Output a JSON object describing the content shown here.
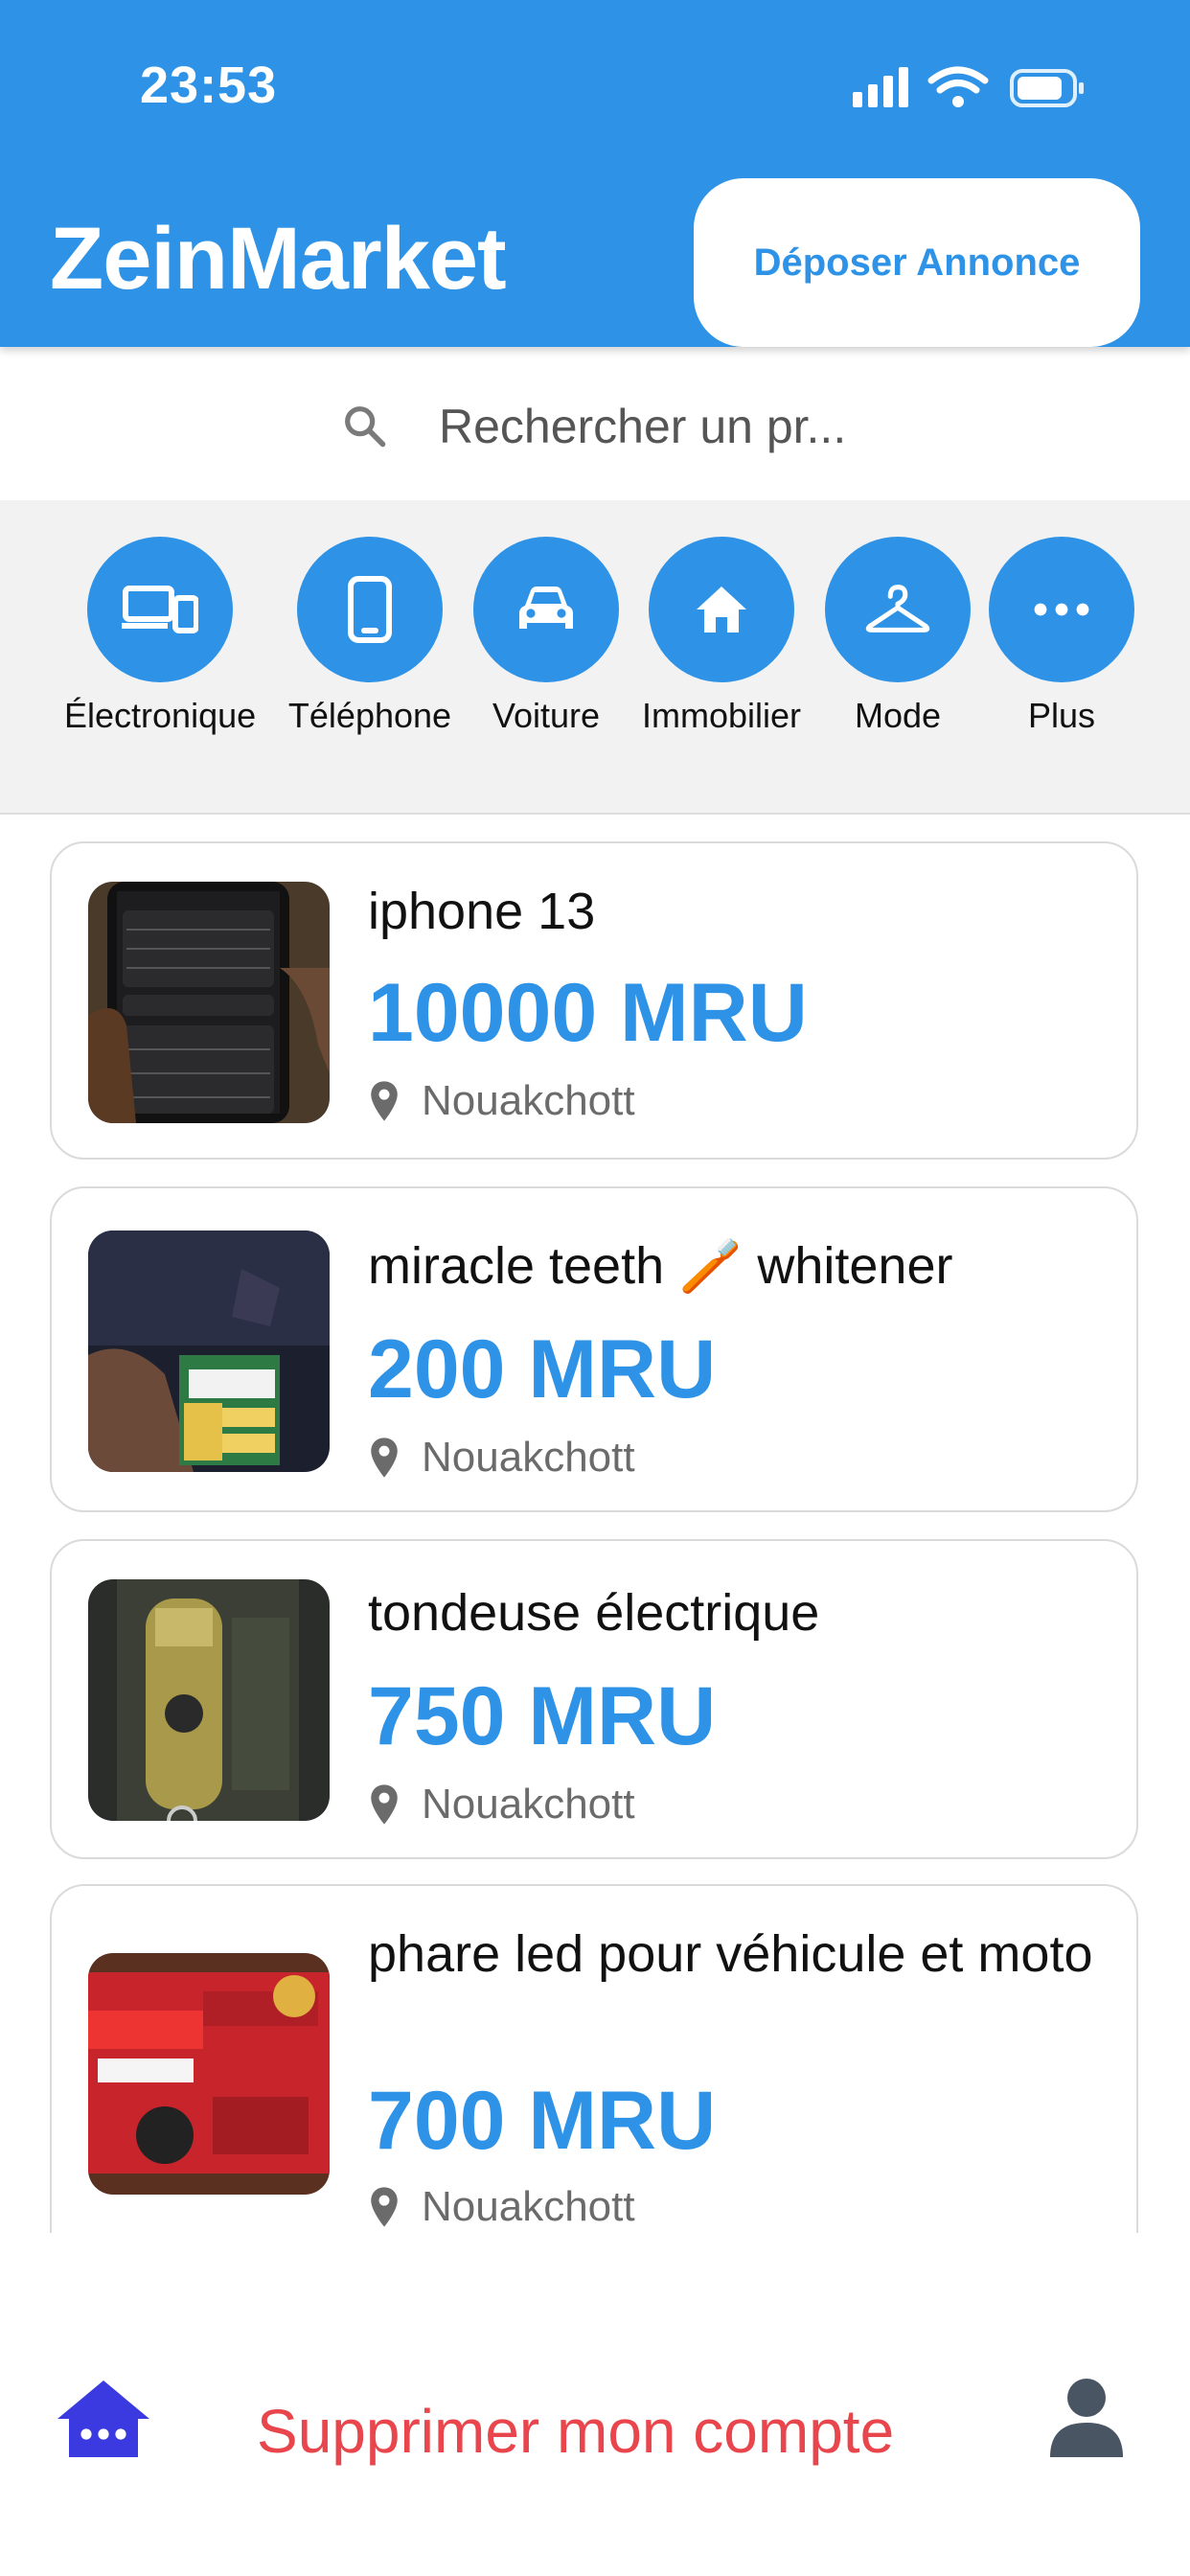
{
  "status_bar": {
    "time": "23:53"
  },
  "header": {
    "app_title": "ZeinMarket",
    "post_button_label": "Déposer Annonce"
  },
  "search": {
    "placeholder": "Rechercher un pr..."
  },
  "categories": [
    {
      "label": "Électronique",
      "icon": "devices-icon"
    },
    {
      "label": "Téléphone",
      "icon": "phone-icon"
    },
    {
      "label": "Voiture",
      "icon": "car-icon"
    },
    {
      "label": "Immobilier",
      "icon": "home-icon"
    },
    {
      "label": "Mode",
      "icon": "hanger-icon"
    },
    {
      "label": "Plus",
      "icon": "more-icon"
    }
  ],
  "listings": [
    {
      "title": "iphone 13",
      "price": "10000 MRU",
      "location": "Nouakchott"
    },
    {
      "title": "miracle teeth 🪥 whitener",
      "price": "200 MRU",
      "location": "Nouakchott"
    },
    {
      "title": "tondeuse électrique",
      "price": "750 MRU",
      "location": "Nouakchott"
    },
    {
      "title": "phare led pour véhicule et moto",
      "price": "700 MRU",
      "location": "Nouakchott"
    }
  ],
  "bottom_bar": {
    "delete_account_label": "Supprimer mon compte"
  },
  "colors": {
    "primary": "#2E93E6",
    "danger": "#E8454C",
    "home_icon": "#3A3AE0"
  }
}
